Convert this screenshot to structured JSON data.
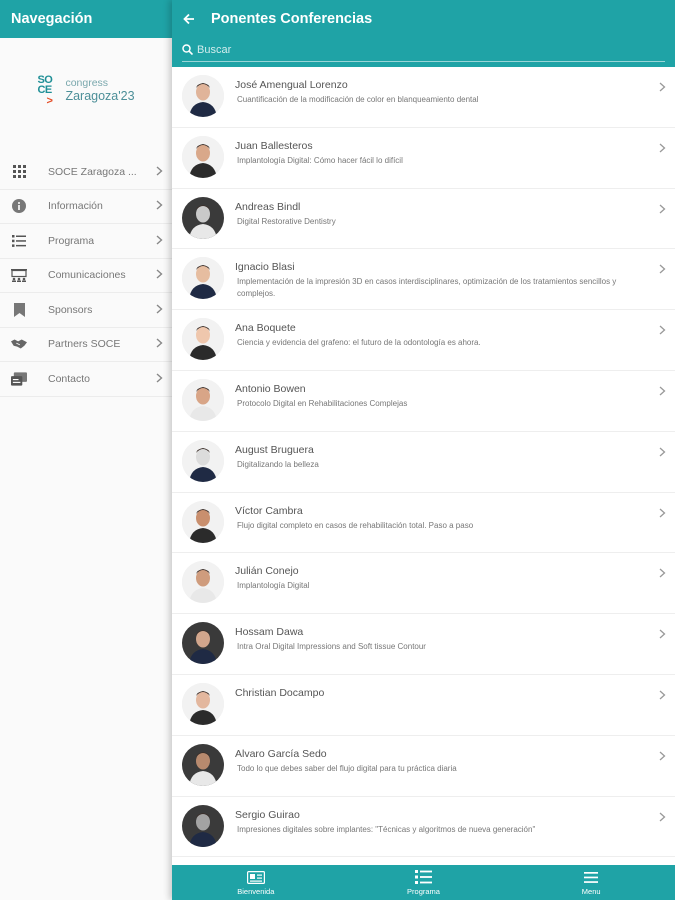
{
  "colors": {
    "accent": "#1fa3a6",
    "avatar_bg": "#e6e6e6"
  },
  "sidebar": {
    "title": "Navegación",
    "logo": {
      "small": "congress",
      "big": "Zaragoza'23",
      "mark_top": "SO",
      "mark_bottom": "CE"
    },
    "items": [
      {
        "label": "SOCE Zaragoza ...",
        "icon": "grid-icon"
      },
      {
        "label": "Información",
        "icon": "info-icon"
      },
      {
        "label": "Programa",
        "icon": "list-icon"
      },
      {
        "label": "Comunicaciones",
        "icon": "presentation-icon"
      },
      {
        "label": "Sponsors",
        "icon": "bookmark-icon"
      },
      {
        "label": "Partners SOCE",
        "icon": "handshake-icon"
      },
      {
        "label": "Contacto",
        "icon": "contact-icon"
      }
    ]
  },
  "header": {
    "title": "Ponentes Conferencias",
    "back_icon": "arrow-left-icon"
  },
  "search": {
    "placeholder": "Buscar",
    "icon": "search-icon"
  },
  "speakers": [
    {
      "name": "José Amengual Lorenzo",
      "talk": "Cuantificación de la modificación de color en blanqueamiento dental"
    },
    {
      "name": "Juan Ballesteros",
      "talk": "Implantología Digital: Cómo hacer fácil lo difícil"
    },
    {
      "name": "Andreas Bindl",
      "talk": "Digital Restorative Dentistry"
    },
    {
      "name": "Ignacio Blasi",
      "talk": "Implementación de la impresión 3D en casos interdisciplinares, optimización de los tratamientos sencillos y complejos."
    },
    {
      "name": "Ana Boquete",
      "talk": "Ciencia y evidencia del grafeno: el futuro de la odontología es ahora."
    },
    {
      "name": "Antonio Bowen",
      "talk": "Protocolo Digital en Rehabilitaciones Complejas"
    },
    {
      "name": "August Bruguera",
      "talk": "Digitalizando la belleza"
    },
    {
      "name": "Víctor Cambra",
      "talk": "Flujo digital completo en casos de rehabilitación total. Paso a paso"
    },
    {
      "name": "Julián Conejo",
      "talk": "Implantología Digital"
    },
    {
      "name": "Hossam Dawa",
      "talk": "Intra Oral Digital Impressions and Soft tissue Contour"
    },
    {
      "name": "Christian Docampo",
      "talk": ""
    },
    {
      "name": "Alvaro García Sedo",
      "talk": "Todo lo que debes saber del flujo digital para tu práctica diaria"
    },
    {
      "name": "Sergio Guirao",
      "talk": "Impresiones digitales sobre implantes: \"Técnicas y algoritmos de nueva generación\""
    }
  ],
  "tabs": [
    {
      "label": "Bienvenida",
      "icon": "id-card-icon"
    },
    {
      "label": "Programa",
      "icon": "list-icon"
    },
    {
      "label": "Menu",
      "icon": "hamburger-icon"
    }
  ]
}
